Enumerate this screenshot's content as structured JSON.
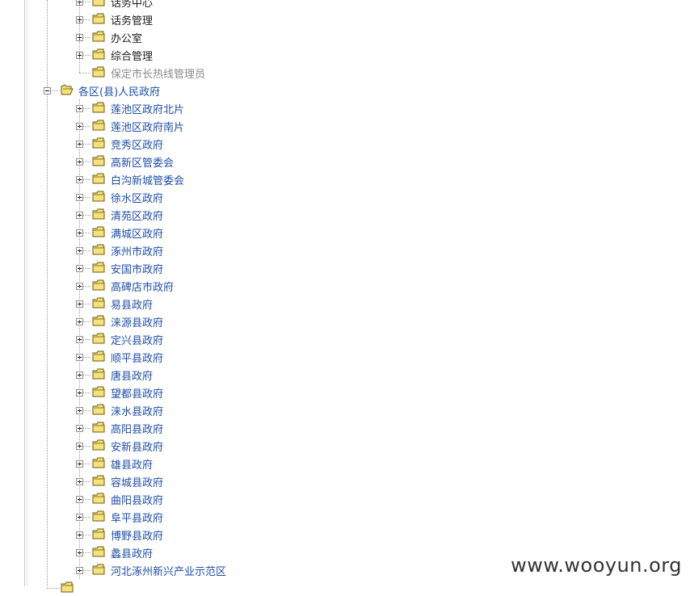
{
  "tree": {
    "level1_parent": {
      "children": [
        {
          "label": "话务中心",
          "style": "plain",
          "expandable": true
        },
        {
          "label": "话务管理",
          "style": "plain",
          "expandable": true
        },
        {
          "label": "办公室",
          "style": "plain",
          "expandable": true
        },
        {
          "label": "综合管理",
          "style": "plain",
          "expandable": true
        },
        {
          "label": "保定市长热线管理员",
          "style": "muted",
          "expandable": false
        }
      ]
    },
    "district_node": {
      "label": "各区(县)人民政府",
      "expanded": true,
      "children": [
        {
          "label": "莲池区政府北片"
        },
        {
          "label": "莲池区政府南片"
        },
        {
          "label": "竞秀区政府"
        },
        {
          "label": "高新区管委会"
        },
        {
          "label": "白沟新城管委会"
        },
        {
          "label": "徐水区政府"
        },
        {
          "label": "清苑区政府"
        },
        {
          "label": "满城区政府"
        },
        {
          "label": "涿州市政府"
        },
        {
          "label": "安国市政府"
        },
        {
          "label": "高碑店市政府"
        },
        {
          "label": "易县政府"
        },
        {
          "label": "涞源县政府"
        },
        {
          "label": "定兴县政府"
        },
        {
          "label": "顺平县政府"
        },
        {
          "label": "唐县政府"
        },
        {
          "label": "望都县政府"
        },
        {
          "label": "涞水县政府"
        },
        {
          "label": "高阳县政府"
        },
        {
          "label": "安新县政府"
        },
        {
          "label": "雄县政府"
        },
        {
          "label": "容城县政府"
        },
        {
          "label": "曲阳县政府"
        },
        {
          "label": "阜平县政府"
        },
        {
          "label": "博野县政府"
        },
        {
          "label": "蠡县政府"
        },
        {
          "label": "河北涿州新兴产业示范区"
        }
      ]
    }
  },
  "colors": {
    "link": "#1f4ea8",
    "plain": "#1c1c1c",
    "muted": "#8b8b8b",
    "folder_fill": "#f6e27a",
    "folder_stroke": "#6b5a12"
  },
  "watermark": {
    "text": "www.wooyun.org"
  },
  "icons": {
    "folder": "folder-icon",
    "open_folder": "folder-open-icon",
    "expander": "plus-minus-box-icon"
  }
}
